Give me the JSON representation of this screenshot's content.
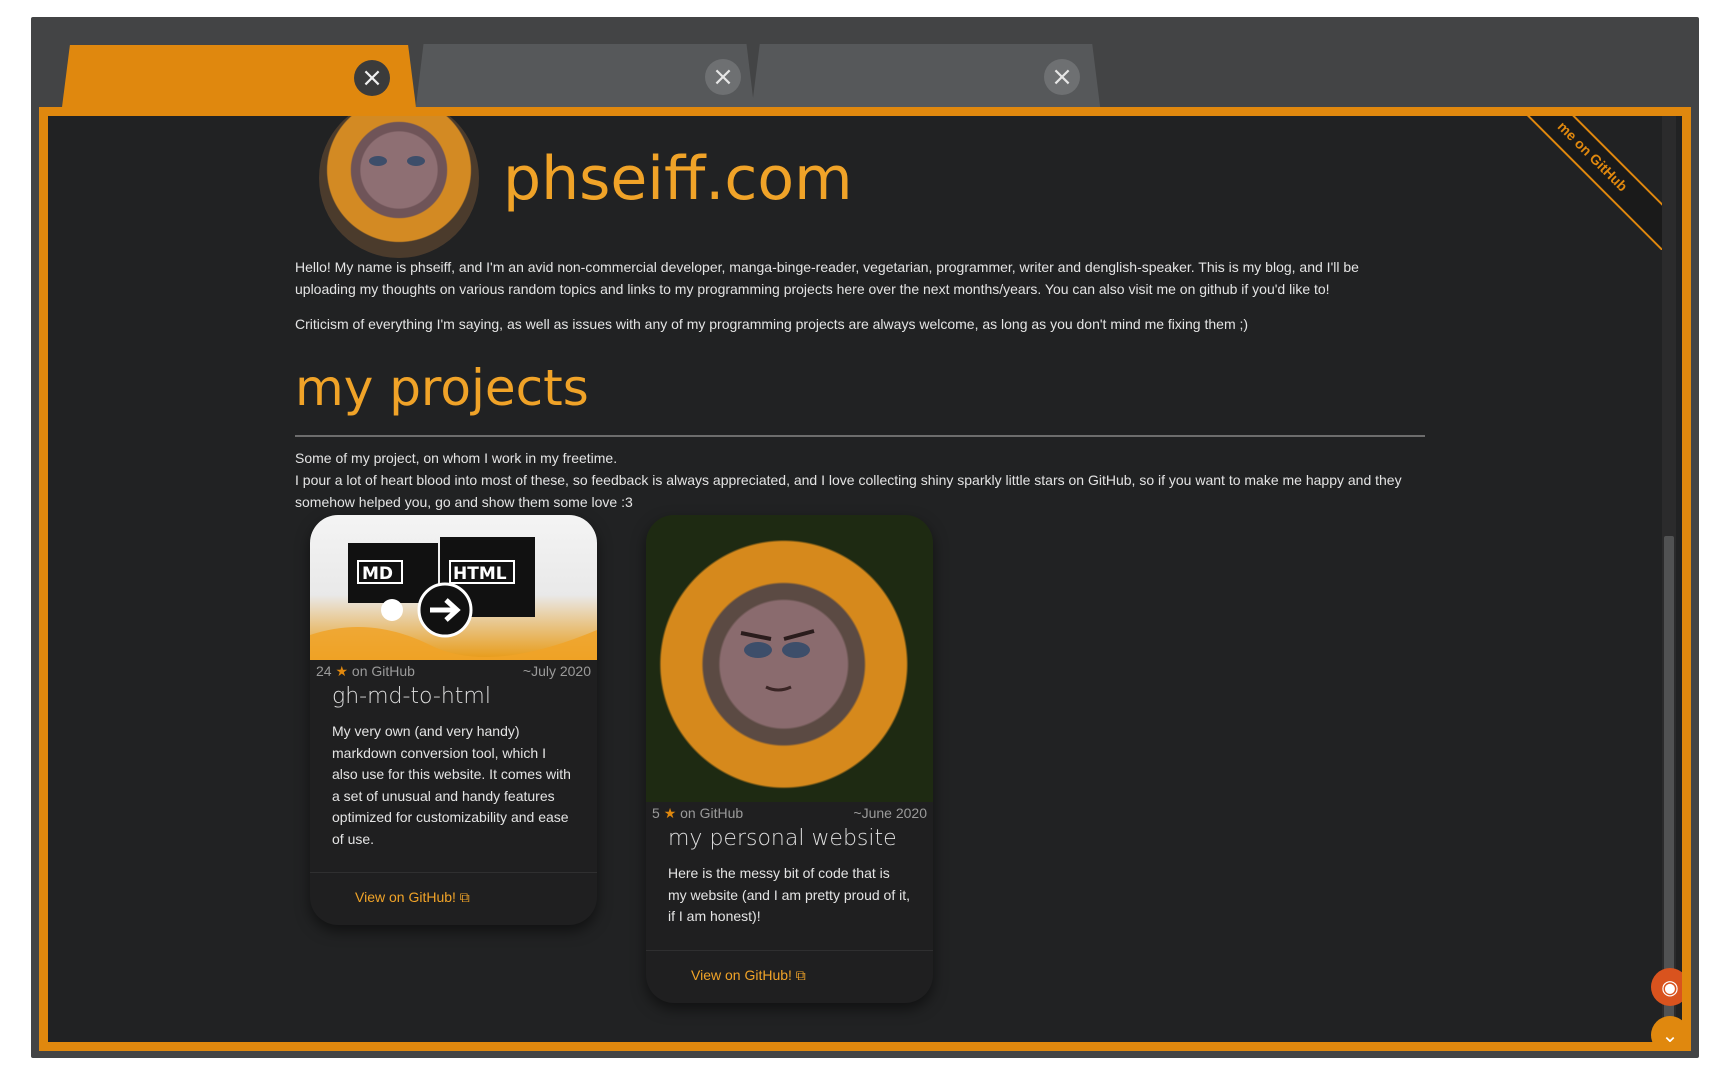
{
  "browser": {
    "tabs": [
      {
        "close_icon": "×"
      },
      {
        "close_icon": "×"
      },
      {
        "close_icon": "×"
      }
    ]
  },
  "ribbon": {
    "text": "me on GitHub"
  },
  "header": {
    "title": "phseiff.com"
  },
  "intro": {
    "p1": "Hello! My name is phseiff, and I'm an avid non-commercial developer, manga-binge-reader, vegetarian, programmer, writer and denglish-speaker. This is my blog, and I'll be uploading my thoughts on various random topics and links to my programming projects here over the next months/years. You can also visit me on github if you'd like to!",
    "p2": "Criticism of everything I'm saying, as well as issues with any of my programming projects are always welcome, as long as you don't mind me fixing them ;)"
  },
  "projects": {
    "heading": "my projects",
    "intro_line1": "Some of my project, on whom I work in my freetime.",
    "intro_line2": "I pour a lot of heart blood into most of these, so feedback is always appreciated, and I love collecting shiny sparkly little stars on GitHub, so if you want to make me happy and they somehow helped you, go and show them some love :3",
    "cards": [
      {
        "stars": "24",
        "stars_suffix": "on GitHub",
        "date": "~July 2020",
        "title": "gh-md-to-html",
        "description": "My very own (and very handy) markdown conversion tool, which I also use for this website. It comes with a set of unusual and handy features optimized for customizability and ease of use.",
        "link": "View on GitHub!",
        "image_label_md": "MD",
        "image_label_html": "HTML"
      },
      {
        "stars": "5",
        "stars_suffix": "on GitHub",
        "date": "~June 2020",
        "title": "my personal website",
        "description": "Here is the messy bit of code that is my website (and I am pretty proud of it, if I am honest)!",
        "link": "View on GitHub!"
      }
    ]
  },
  "fabs": {
    "rss_icon": "rss-icon",
    "scroll_down_icon": "chevron-down-icon"
  },
  "colors": {
    "accent": "#e0880e",
    "title": "#f0a328",
    "background": "#212223",
    "rss": "#d9531e"
  }
}
